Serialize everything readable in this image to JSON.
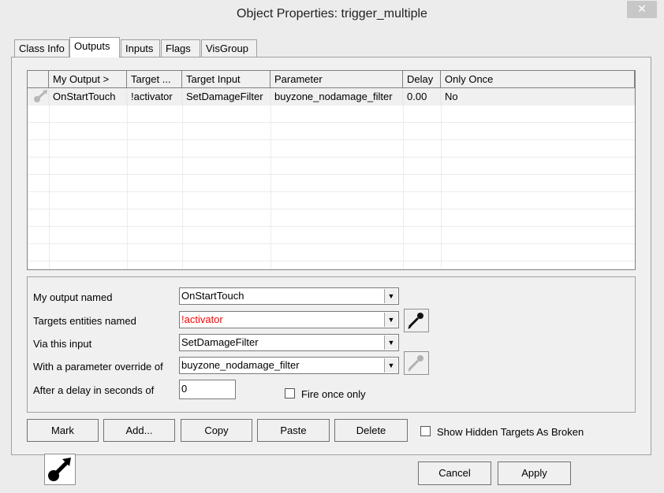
{
  "window": {
    "title": "Object Properties: trigger_multiple",
    "close_glyph": "✕"
  },
  "tabs": [
    {
      "label": "Class Info"
    },
    {
      "label": "Outputs"
    },
    {
      "label": "Inputs"
    },
    {
      "label": "Flags"
    },
    {
      "label": "VisGroup"
    }
  ],
  "grid": {
    "columns": [
      "My Output  >",
      "Target ...",
      "Target Input",
      "Parameter",
      "Delay",
      "Only Once"
    ],
    "rows": [
      {
        "icon": "connection-icon",
        "cells": [
          "OnStartTouch",
          "!activator",
          "SetDamageFilter",
          "buyzone_nodamage_filter",
          "0.00",
          "No"
        ]
      }
    ]
  },
  "form": {
    "output_label": "My output named",
    "output_value": "OnStartTouch",
    "targets_label": "Targets entities named",
    "targets_value": "!activator",
    "targets_color": "#ff0000",
    "input_label": "Via this input",
    "input_value": "SetDamageFilter",
    "param_label": "With a parameter override of",
    "param_value": "buyzone_nodamage_filter",
    "delay_label": "After a delay in seconds of",
    "delay_value": "0",
    "fire_once_label": "Fire once only",
    "fire_once_checked": false
  },
  "buttons": {
    "mark": "Mark",
    "add": "Add...",
    "copy": "Copy",
    "paste": "Paste",
    "delete": "Delete",
    "show_hidden_label": "Show Hidden Targets As Broken",
    "cancel": "Cancel",
    "apply": "Apply"
  },
  "icons": {
    "entity_status": "connection-plug-icon",
    "eyedropper": "eyedropper-icon"
  }
}
